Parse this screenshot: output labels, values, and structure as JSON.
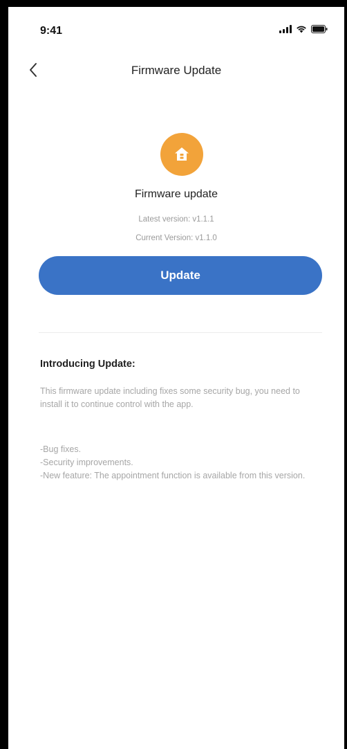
{
  "status_bar": {
    "time": "9:41"
  },
  "nav": {
    "title": "Firmware Update",
    "back_icon": "chevron-left-icon"
  },
  "device": {
    "icon": "home-icon",
    "icon_color": "#f2a33a",
    "title": "Firmware update",
    "latest_version": "Latest version: v1.1.1",
    "current_version": "Current Version: v1.1.0"
  },
  "actions": {
    "update_label": "Update",
    "button_color": "#3a73c6"
  },
  "intro": {
    "heading": "Introducing Update:",
    "body": "This firmware update including fixes some security bug, you need to install it to continue control with the app.",
    "features": [
      "-Bug fixes.",
      "-Security improvements.",
      "-New feature: The appointment function is available from this version."
    ]
  }
}
